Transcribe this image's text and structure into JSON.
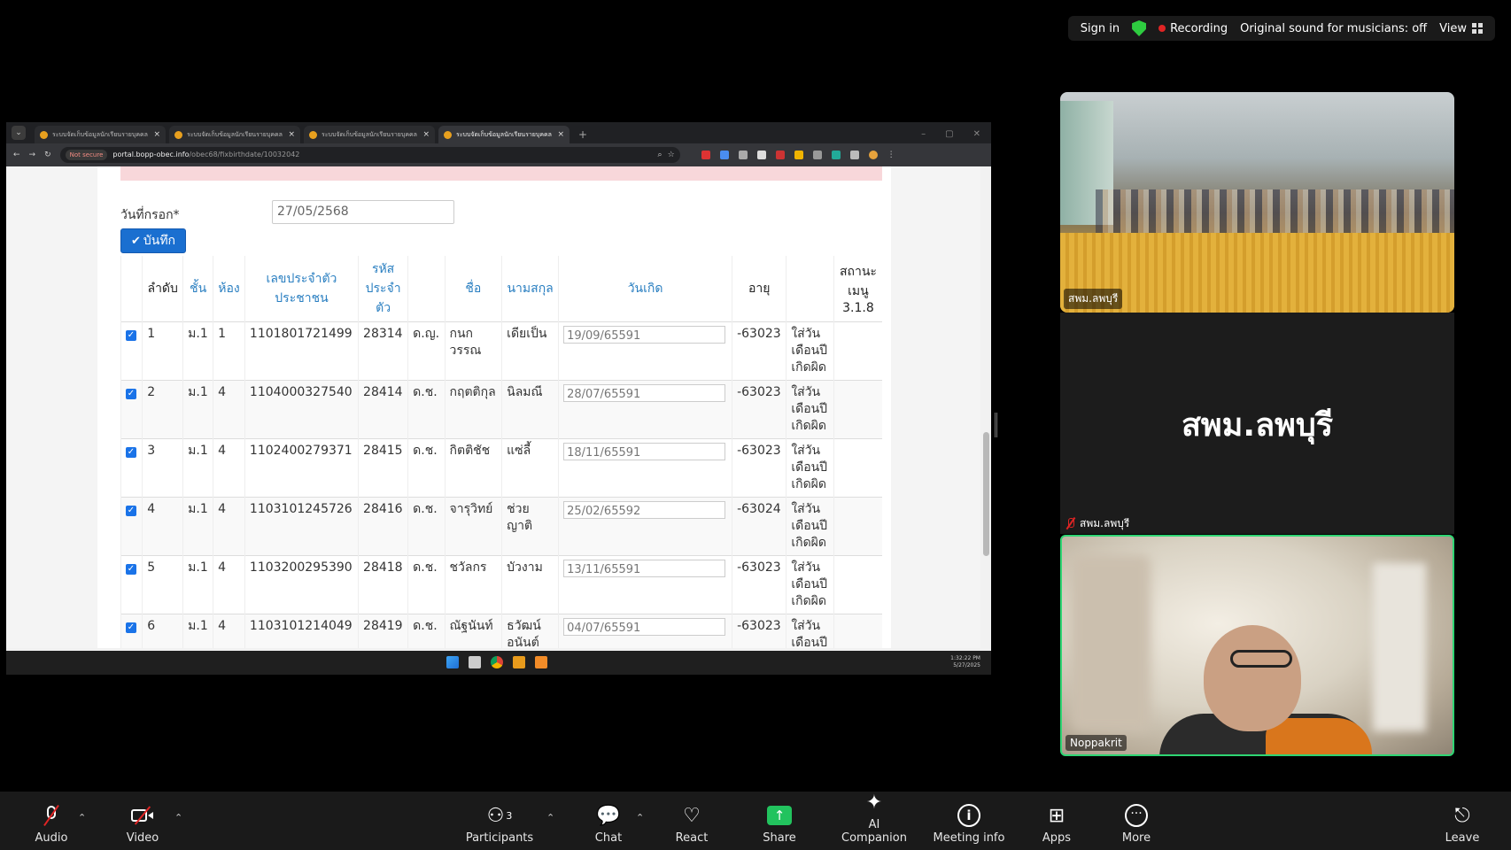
{
  "zoom_top": {
    "sign_in": "Sign in",
    "recording": "Recording",
    "original_sound": "Original sound for musicians: off",
    "view": "View"
  },
  "browser": {
    "tabs": [
      {
        "title": "ระบบจัดเก็บข้อมูลนักเรียนรายบุคคล"
      },
      {
        "title": "ระบบจัดเก็บข้อมูลนักเรียนรายบุคคล"
      },
      {
        "title": "ระบบจัดเก็บข้อมูลนักเรียนรายบุคคล"
      },
      {
        "title": "ระบบจัดเก็บข้อมูลนักเรียนรายบุคคล"
      }
    ],
    "not_secure": "Not secure",
    "url_host": "portal.bopp-obec.info",
    "url_path": "/obec68/fixbirthdate/10032042"
  },
  "form": {
    "date_label": "วันที่กรอก*",
    "date_value": "27/05/2568",
    "save_label": "บันทึก"
  },
  "table": {
    "headers": {
      "order": "ลำดับ",
      "level": "ชั้น",
      "room": "ห้อง",
      "citizen_id": "เลขประจำตัวประชาชน",
      "student_code": "รหัสประจำตัว",
      "title": "",
      "first_name": "ชื่อ",
      "last_name": "นามสกุล",
      "birthdate": "วันเกิด",
      "age": "อายุ",
      "note": "",
      "menu_status": "สถานะเมนู 3.1.8"
    },
    "rows": [
      {
        "order": "1",
        "level": "ม.1",
        "room": "1",
        "citizen_id": "1101801721499",
        "student_code": "28314",
        "title": "ด.ญ.",
        "first_name": "กนกวรรณ",
        "last_name": "เดียเป็น",
        "birthdate": "19/09/65591",
        "age": "-63023",
        "note": "ใส่วันเดือนปีเกิดผิด"
      },
      {
        "order": "2",
        "level": "ม.1",
        "room": "4",
        "citizen_id": "1104000327540",
        "student_code": "28414",
        "title": "ด.ช.",
        "first_name": "กฤตติกุล",
        "last_name": "นิลมณี",
        "birthdate": "28/07/65591",
        "age": "-63023",
        "note": "ใส่วันเดือนปีเกิดผิด"
      },
      {
        "order": "3",
        "level": "ม.1",
        "room": "4",
        "citizen_id": "1102400279371",
        "student_code": "28415",
        "title": "ด.ช.",
        "first_name": "กิตติชัช",
        "last_name": "แซ่ลี้",
        "birthdate": "18/11/65591",
        "age": "-63023",
        "note": "ใส่วันเดือนปีเกิดผิด"
      },
      {
        "order": "4",
        "level": "ม.1",
        "room": "4",
        "citizen_id": "1103101245726",
        "student_code": "28416",
        "title": "ด.ช.",
        "first_name": "จารุวิทย์",
        "last_name": "ช่วยญาติ",
        "birthdate": "25/02/65592",
        "age": "-63024",
        "note": "ใส่วันเดือนปีเกิดผิด"
      },
      {
        "order": "5",
        "level": "ม.1",
        "room": "4",
        "citizen_id": "1103200295390",
        "student_code": "28418",
        "title": "ด.ช.",
        "first_name": "ชวัลกร",
        "last_name": "บัวงาม",
        "birthdate": "13/11/65591",
        "age": "-63023",
        "note": "ใส่วันเดือนปีเกิดผิด"
      },
      {
        "order": "6",
        "level": "ม.1",
        "room": "4",
        "citizen_id": "1103101214049",
        "student_code": "28419",
        "title": "ด.ช.",
        "first_name": "ณัฐนันท์",
        "last_name": "ธวัฒน์อนันต์",
        "birthdate": "04/07/65591",
        "age": "-63023",
        "note": "ใส่วันเดือนปีเกิดผิด"
      }
    ]
  },
  "taskbar": {
    "time": "1:32:22 PM",
    "date": "5/27/2025"
  },
  "videos": {
    "room_label": "สพม.ลพบุรี",
    "name_card": "สพม.ลพบุรี",
    "name_card_label": "สพม.ลพบุรี",
    "speaker_label": "Noppakrit"
  },
  "toolbar": {
    "audio": "Audio",
    "video": "Video",
    "participants": "Participants",
    "participants_count": "3",
    "chat": "Chat",
    "react": "React",
    "share": "Share",
    "ai_companion": "AI Companion",
    "meeting_info": "Meeting info",
    "apps": "Apps",
    "more": "More",
    "leave": "Leave"
  }
}
